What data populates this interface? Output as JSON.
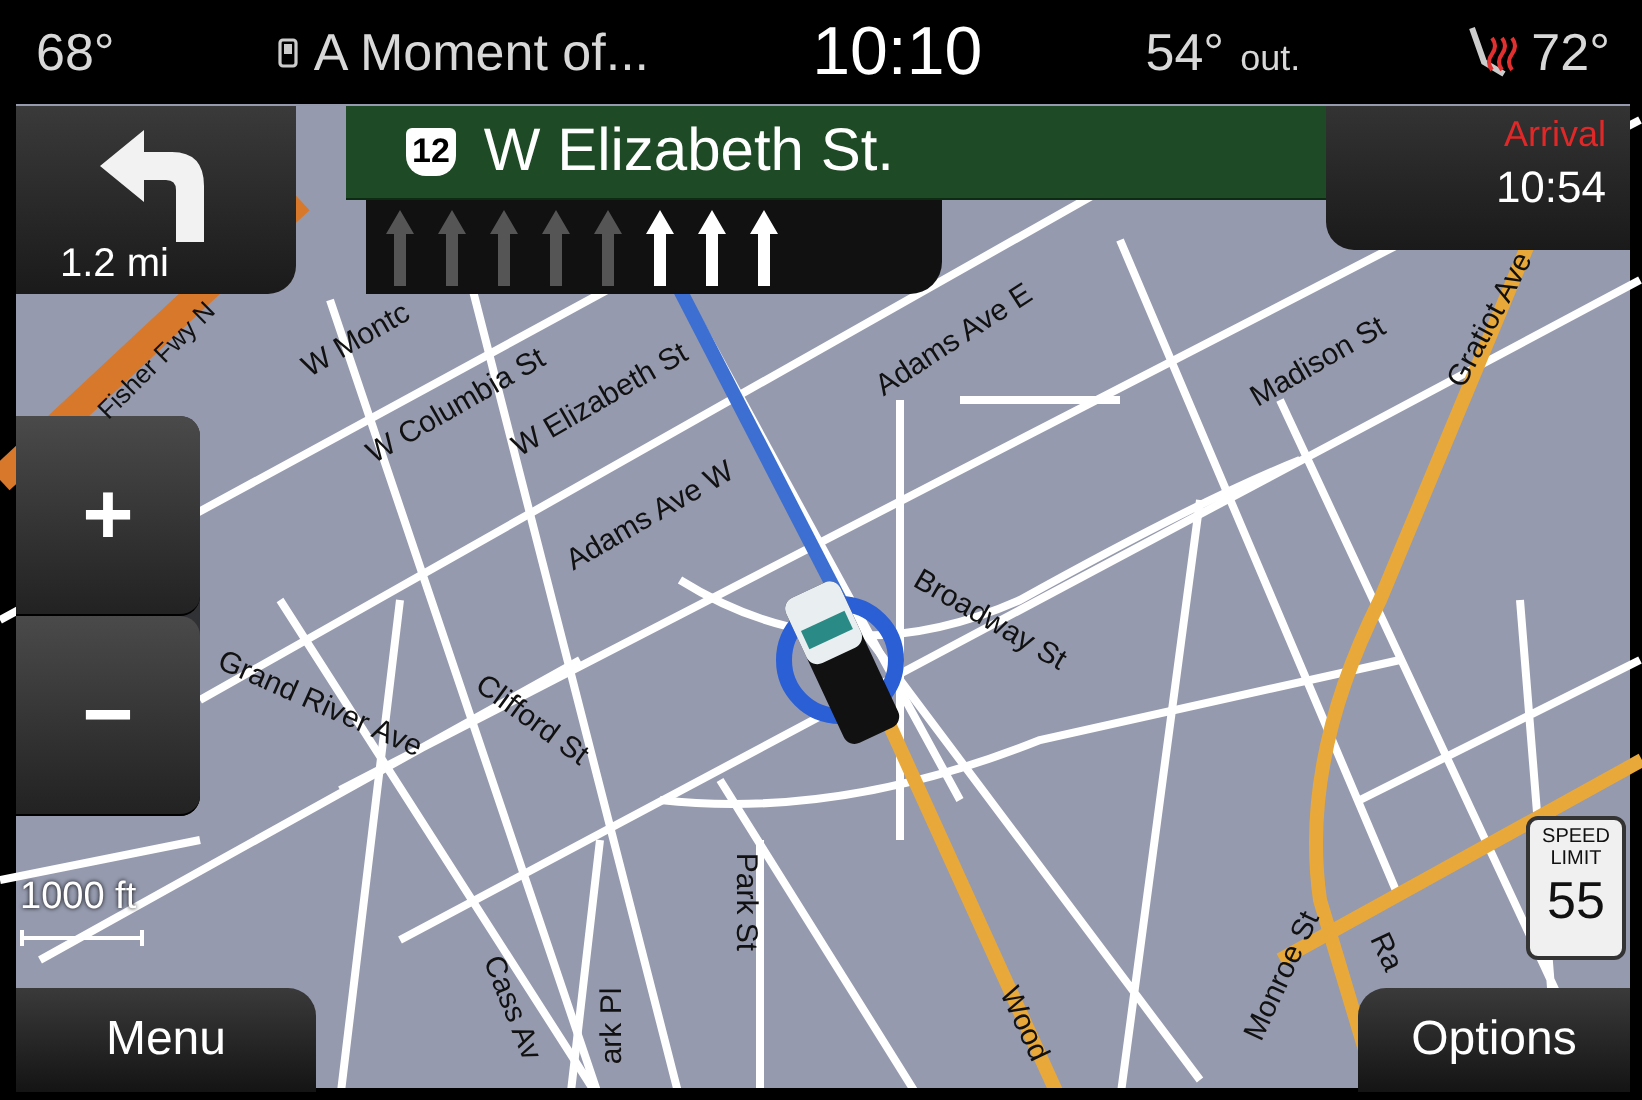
{
  "status_bar": {
    "inside_temp": "68°",
    "media": "A Moment of...",
    "clock": "10:10",
    "outside_temp": "54°",
    "outside_label": "out.",
    "seat_heat": {
      "on": true
    },
    "climate_temp": "72°"
  },
  "maneuver": {
    "distance": "1.2 mi"
  },
  "next_street": {
    "route_number": "12",
    "name": "W Elizabeth St."
  },
  "lanes": [
    {
      "active": false
    },
    {
      "active": false
    },
    {
      "active": false
    },
    {
      "active": false
    },
    {
      "active": false
    },
    {
      "active": true
    },
    {
      "active": true
    },
    {
      "active": true
    }
  ],
  "arrival": {
    "label": "Arrival",
    "time": "10:54"
  },
  "zoom": {
    "in": "+",
    "out": "−"
  },
  "scale": "1000 ft",
  "speed_limit": {
    "line_1": "SPEED",
    "line_2": "LIMIT",
    "value": "55"
  },
  "streets": [
    {
      "name": "Fisher Fwy N"
    },
    {
      "name": "W Montc"
    },
    {
      "name": "W Columbia St"
    },
    {
      "name": "W Elizabeth St"
    },
    {
      "name": "Adams Ave W"
    },
    {
      "name": "Grand River Ave"
    },
    {
      "name": "Clifford St"
    },
    {
      "name": "Adams Ave E"
    },
    {
      "name": "Broadway St"
    },
    {
      "name": "Madison St"
    },
    {
      "name": "Gratiot Ave"
    },
    {
      "name": "Cass Av"
    },
    {
      "name": "ark Pl"
    },
    {
      "name": "Park St"
    },
    {
      "name": "Wood"
    },
    {
      "name": "Monroe St"
    },
    {
      "name": "Ra"
    }
  ],
  "buttons": {
    "menu": "Menu",
    "options": "Options"
  }
}
